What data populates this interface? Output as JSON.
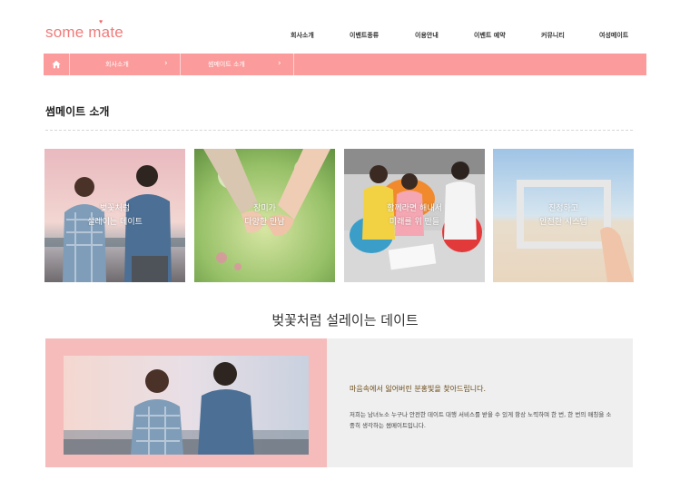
{
  "header": {
    "logo": {
      "text_pre": "some m",
      "text_post": "te",
      "accent_char": "a",
      "heart": "♥"
    },
    "nav": [
      {
        "label": "회사소개"
      },
      {
        "label": "이벤트종류"
      },
      {
        "label": "이용안내"
      },
      {
        "label": "이벤트 예약"
      },
      {
        "label": "커뮤니티"
      },
      {
        "label": "여성메이트"
      }
    ]
  },
  "breadcrumb": {
    "home_icon": "home-icon",
    "items": [
      {
        "label": "회사소개"
      },
      {
        "label": "썸메이트 소개"
      }
    ],
    "separator": "›"
  },
  "page": {
    "title": "썸메이트 소개"
  },
  "cards": [
    {
      "line1": "벚꽃처럼",
      "line2": "설레이는 데이트"
    },
    {
      "line1": "장미가",
      "line2": "다양한 만남"
    },
    {
      "line1": "함께라면 해내서",
      "line2": "미래를 위 만들"
    },
    {
      "line1": "진정하고",
      "line2": "안전한 시스템"
    }
  ],
  "section": {
    "heading": "벚꽃처럼 설레이는 데이트",
    "headline": "마음속에서 잃어버린 분홍빛을 찾아드립니다.",
    "body": "저희는 남녀노소 누구나 안전한 데이트 대행 서비스를 받을 수 있게 항상 노력하며 한 번, 한 번의 매칭을 소중히 생각하는 썸메이트입니다."
  },
  "colors": {
    "brand_pink": "#fb9b9b",
    "logo_pink": "#ef7b7b",
    "feature_pink": "#f6bcbc",
    "feature_gray": "#efefef",
    "headline_brown": "#6b4a16"
  }
}
